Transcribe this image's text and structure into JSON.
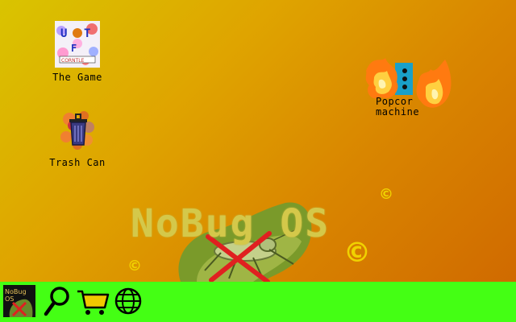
{
  "desktop": {
    "icons": [
      {
        "label": "The Game",
        "icon": "game-icon",
        "badge_top": "U●T",
        "badge_mid": "F",
        "badge_bottom": "CORNTLE"
      },
      {
        "label": "Trash Can",
        "icon": "trash-can-icon"
      },
      {
        "label": "Popcorn machine",
        "label_line1": "Popcor",
        "label_line2": "machine",
        "icon": "popcorn-machine-icon"
      }
    ],
    "logo_text": "NoBug OS",
    "copyright_symbol": "©",
    "background_colors": [
      "#d9c400",
      "#d06a00"
    ]
  },
  "taskbar": {
    "color": "#44ff14",
    "start_label_line1": "NoBug OS",
    "items": [
      {
        "name": "search",
        "icon": "magnifier-icon"
      },
      {
        "name": "shop",
        "icon": "shopping-cart-icon"
      },
      {
        "name": "internet",
        "icon": "globe-icon"
      }
    ]
  }
}
